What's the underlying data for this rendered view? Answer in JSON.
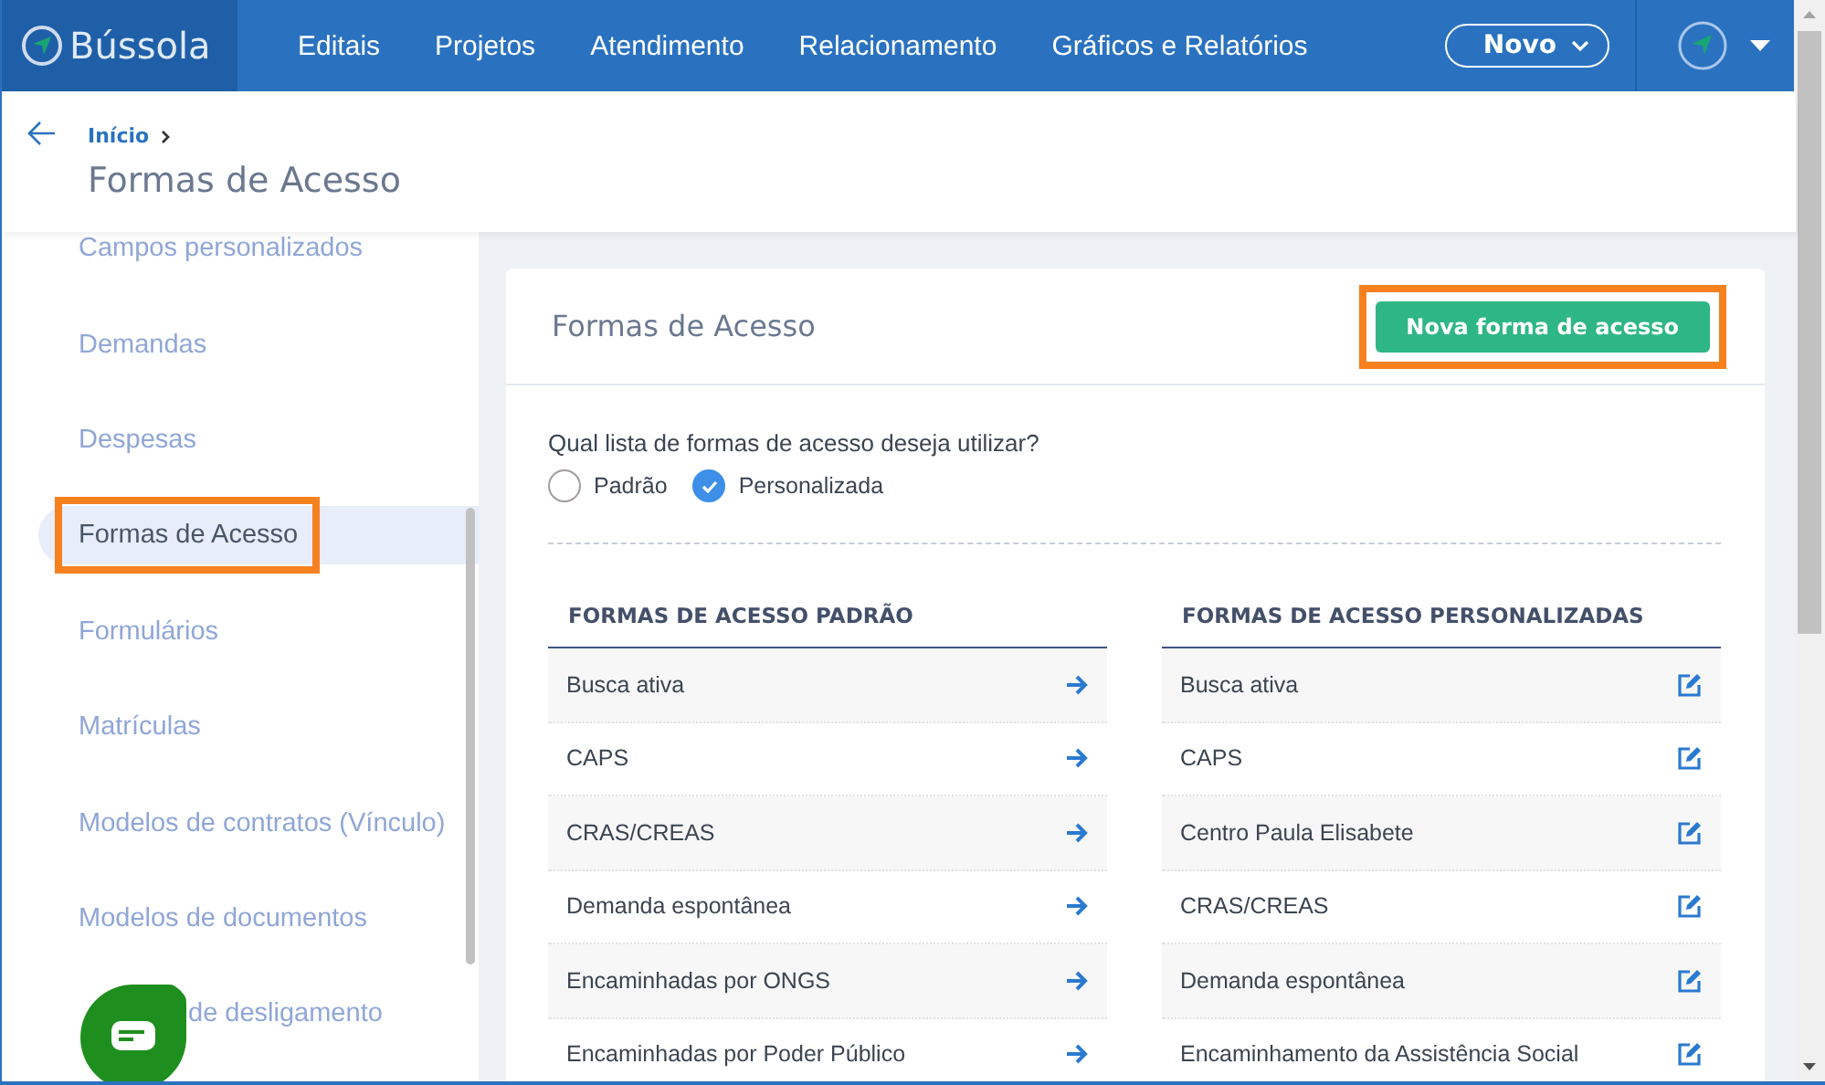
{
  "header": {
    "logo": "Bússola",
    "nav": [
      {
        "label": "Editais"
      },
      {
        "label": "Projetos"
      },
      {
        "label": "Atendimento"
      },
      {
        "label": "Relacionamento"
      },
      {
        "label": "Gráficos e Relatórios"
      }
    ],
    "new_button": "Novo"
  },
  "breadcrumb": {
    "items": [
      "Início"
    ],
    "title": "Formas de Acesso"
  },
  "sidebar": {
    "items": [
      {
        "label": "Campos personalizados",
        "selected": false,
        "highlighted": false,
        "partly_covered": false
      },
      {
        "label": "Demandas",
        "selected": false,
        "highlighted": false,
        "partly_covered": false
      },
      {
        "label": "Despesas",
        "selected": false,
        "highlighted": false,
        "partly_covered": false
      },
      {
        "label": "Formas de Acesso",
        "selected": true,
        "highlighted": true,
        "partly_covered": false
      },
      {
        "label": "Formulários",
        "selected": false,
        "highlighted": false,
        "partly_covered": false
      },
      {
        "label": "Matrículas",
        "selected": false,
        "highlighted": false,
        "partly_covered": false
      },
      {
        "label": "Modelos de contratos (Vínculo)",
        "selected": false,
        "highlighted": false,
        "partly_covered": false
      },
      {
        "label": "Modelos de documentos",
        "selected": false,
        "highlighted": false,
        "partly_covered": false
      },
      {
        "label": "de desligamento",
        "selected": false,
        "highlighted": false,
        "partly_covered": true
      }
    ]
  },
  "card": {
    "title": "Formas de Acesso",
    "action": {
      "label": "Nova forma de acesso",
      "highlighted": true
    },
    "question": "Qual lista de formas de acesso deseja utilizar?",
    "options": [
      {
        "label": "Padrão",
        "selected": false
      },
      {
        "label": "Personalizada",
        "selected": true
      }
    ],
    "lists": [
      {
        "heading": "FORMAS DE ACESSO PADRÃO",
        "kind": "arrow",
        "items": [
          "Busca ativa",
          "CAPS",
          "CRAS/CREAS",
          "Demanda espontânea",
          "Encaminhadas por ONGS",
          "Encaminhadas por Poder Público"
        ]
      },
      {
        "heading": "FORMAS DE ACESSO PERSONALIZADAS",
        "kind": "edit",
        "items": [
          "Busca ativa",
          "CAPS",
          "Centro Paula Elisabete",
          "CRAS/CREAS",
          "Demanda espontânea",
          "Encaminhamento da Assistência Social"
        ]
      }
    ]
  }
}
